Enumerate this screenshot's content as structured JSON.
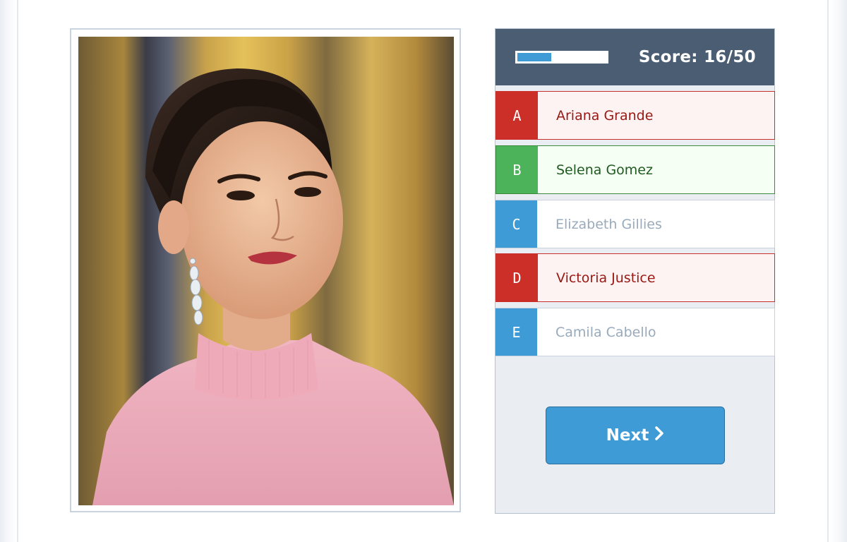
{
  "quiz": {
    "score_text": "Score: 16/50",
    "progress": 0.38,
    "options": [
      {
        "letter": "A",
        "label": "Ariana Grande",
        "state": "wrong"
      },
      {
        "letter": "B",
        "label": "Selena Gomez",
        "state": "correct"
      },
      {
        "letter": "C",
        "label": "Elizabeth Gillies",
        "state": "neutral"
      },
      {
        "letter": "D",
        "label": "Victoria Justice",
        "state": "wrong"
      },
      {
        "letter": "E",
        "label": "Camila Cabello",
        "state": "neutral"
      }
    ],
    "next_label": "Next",
    "next_icon": "chevron-right-icon"
  },
  "photo": {
    "subject": "portrait-photo"
  },
  "colors": {
    "header_bg": "#4a5d73",
    "accent_blue": "#3e9bd6",
    "wrong_red": "#cc2f27",
    "correct_green": "#4cb35a",
    "panel_bg": "#eaedf2"
  }
}
